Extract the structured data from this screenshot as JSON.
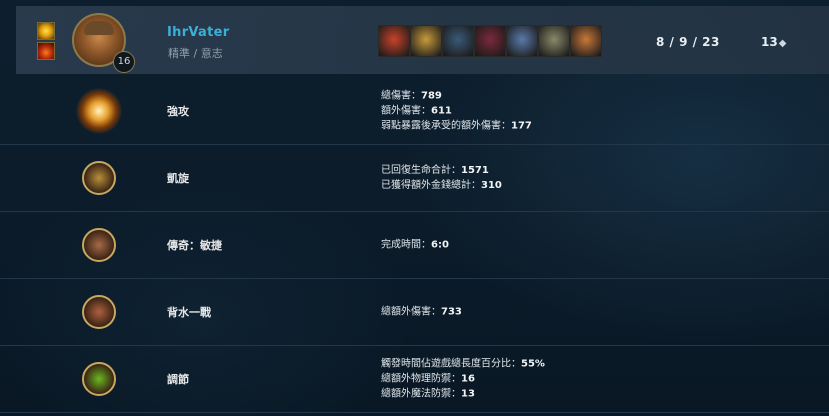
{
  "header": {
    "summoner_name": "IhrVater",
    "rune_paths": "精準 / 意志",
    "champion_level": "16",
    "summoner_spells": [
      "spell-hexflash-icon",
      "spell-ignite-icon"
    ],
    "items": [
      {
        "icon": "item-1-icon",
        "color": "#c8432a"
      },
      {
        "icon": "item-2-icon",
        "color": "#c89a3a"
      },
      {
        "icon": "item-3-icon",
        "color": "#3a5a78"
      },
      {
        "icon": "item-4-icon",
        "color": "#7a2a3a"
      },
      {
        "icon": "item-5-icon",
        "color": "#5a7aa8"
      },
      {
        "icon": "item-6-icon",
        "color": "#8a8a6a"
      },
      {
        "icon": "item-7-icon",
        "color": "#c87838"
      }
    ],
    "kda": "8 / 9 / 23",
    "cs": "13",
    "cs_icon": "minion-icon"
  },
  "runes": [
    {
      "name": "強攻",
      "icon": "press-the-attack-icon",
      "color": "#e8a030",
      "stats": [
        {
          "label": "總傷害：",
          "value": "789"
        },
        {
          "label": "額外傷害：",
          "value": "611"
        },
        {
          "label": "弱點暴露後承受的額外傷害：",
          "value": "177"
        }
      ]
    },
    {
      "name": "凱旋",
      "icon": "triumph-icon",
      "color": "#b8903a",
      "stats": [
        {
          "label": "已回復生命合計：",
          "value": "1571"
        },
        {
          "label": "已獲得額外金錢總計：",
          "value": "310"
        }
      ]
    },
    {
      "name": "傳奇：敏捷",
      "icon": "legend-alacrity-icon",
      "color": "#a86a48",
      "stats": [
        {
          "label": "完成時間：",
          "value": "6:0"
        }
      ]
    },
    {
      "name": "背水一戰",
      "icon": "last-stand-icon",
      "color": "#b06040",
      "stats": [
        {
          "label": "總額外傷害：",
          "value": "733"
        }
      ]
    },
    {
      "name": "調節",
      "icon": "conditioning-icon",
      "color": "#6ab820",
      "stats": [
        {
          "label": "觸發時間佔遊戲總長度百分比：",
          "value": "55%"
        },
        {
          "label": "總額外物理防禦：",
          "value": "16"
        },
        {
          "label": "總額外魔法防禦：",
          "value": "13"
        }
      ]
    }
  ]
}
